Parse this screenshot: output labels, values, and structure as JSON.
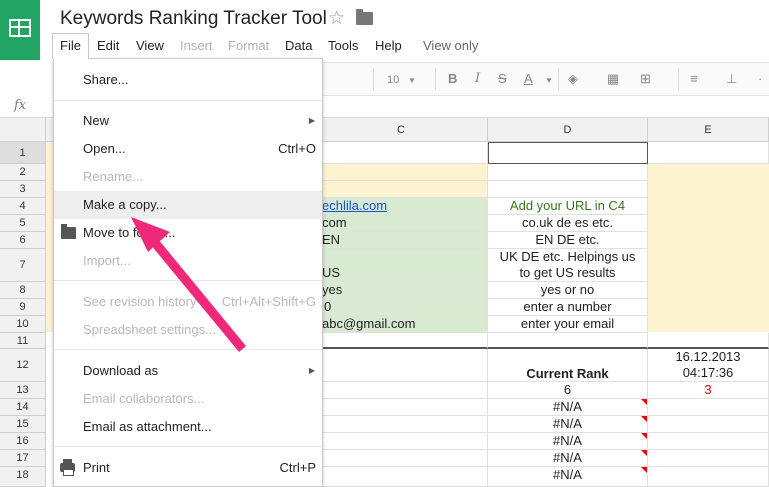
{
  "app": {
    "title": "Keywords Ranking Tracker Tool"
  },
  "menubar": [
    {
      "label": "File"
    },
    {
      "label": "Edit"
    },
    {
      "label": "View"
    },
    {
      "label": "Insert"
    },
    {
      "label": "Format"
    },
    {
      "label": "Data"
    },
    {
      "label": "Tools"
    },
    {
      "label": "Help"
    },
    {
      "label": "View only"
    }
  ],
  "toolbar": {
    "font_size": "10",
    "bold": "B",
    "text_color": "A"
  },
  "formula_bar": {
    "fx": "fx"
  },
  "columns": [
    "C",
    "D",
    "E"
  ],
  "rows": [
    "1",
    "2",
    "3",
    "4",
    "5",
    "6",
    "7",
    "8",
    "9",
    "10",
    "11",
    "12",
    "13",
    "14",
    "15",
    "16",
    "17",
    "18"
  ],
  "cells": {
    "c4": "echlila.com",
    "c5": "com",
    "c6": "EN",
    "c7": "US",
    "c8": "yes",
    "c9": "0",
    "c10": "abc@gmail.com",
    "d4": "Add your URL in C4",
    "d5": "co.uk de es etc.",
    "d6": "EN DE etc.",
    "d7a": "UK DE etc. Helpings us",
    "d7b": "to get US results",
    "d8": "yes or no",
    "d9": "enter a number",
    "d10": "enter your email",
    "d12": "Current Rank",
    "d13": "6",
    "na": "#N/A",
    "e12a": "16.12.2013",
    "e12b": "04:17:36",
    "e13": "3"
  },
  "file_menu": {
    "share": "Share...",
    "new": "New",
    "open": "Open...",
    "open_sc": "Ctrl+O",
    "rename": "Rename...",
    "make_copy": "Make a copy...",
    "move_to": "Move to folder...",
    "import": "Import...",
    "revision": "See revision history",
    "revision_sc": "Ctrl+Alt+Shift+G",
    "settings": "Spreadsheet settings...",
    "download": "Download as",
    "collaborators": "Email collaborators...",
    "attachment": "Email as attachment...",
    "print": "Print",
    "print_sc": "Ctrl+P"
  },
  "colors": {
    "green_logo": "#21a464",
    "yellow_fill": "#fdf3d0",
    "green_fill": "#d9ead3",
    "link": "#1155cc",
    "arrow": "#f0287a",
    "green_text": "#38761d",
    "red_text": "#e00000"
  }
}
